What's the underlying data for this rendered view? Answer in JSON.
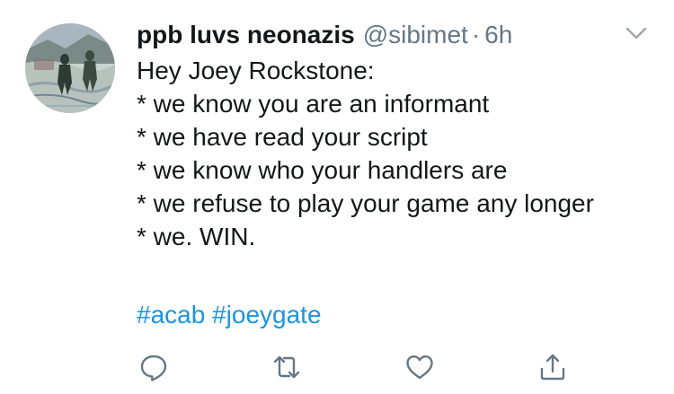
{
  "tweet": {
    "display_name": "ppb luvs neonazis",
    "handle": "@sibimet",
    "separator": "·",
    "timestamp": "6h",
    "body_lines": [
      "Hey Joey Rockstone:",
      "* we know you are an informant",
      "* we have read your script",
      "* we know who your handlers are",
      "* we refuse to play your game any longer",
      "* we. WIN."
    ],
    "hashtags": [
      "#acab",
      "#joeygate"
    ]
  },
  "icons": {
    "menu": "chevron-down-icon",
    "reply": "reply-icon",
    "retweet": "retweet-icon",
    "like": "heart-icon",
    "share": "share-icon"
  },
  "colors": {
    "text": "#14171a",
    "secondary": "#657786",
    "link": "#1b95e0",
    "icon": "#657786"
  }
}
